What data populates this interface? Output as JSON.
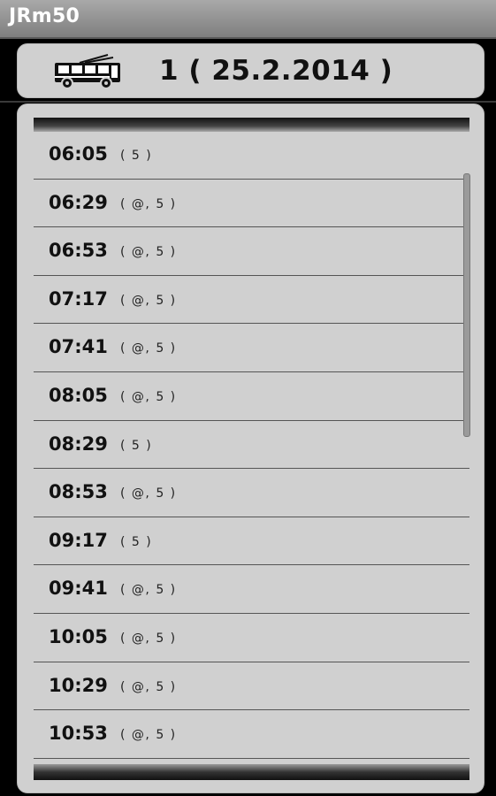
{
  "app": {
    "title": "JRm50"
  },
  "header": {
    "line_title": "1 ( 25.2.2014 )",
    "vehicle_icon": "trolleybus-icon"
  },
  "departures": [
    {
      "time": "06:05",
      "note": "( 5 )"
    },
    {
      "time": "06:29",
      "note": "( @, 5 )"
    },
    {
      "time": "06:53",
      "note": "( @, 5 )"
    },
    {
      "time": "07:17",
      "note": "( @, 5 )"
    },
    {
      "time": "07:41",
      "note": "( @, 5 )"
    },
    {
      "time": "08:05",
      "note": "( @, 5 )"
    },
    {
      "time": "08:29",
      "note": "( 5 )"
    },
    {
      "time": "08:53",
      "note": "( @, 5 )"
    },
    {
      "time": "09:17",
      "note": "( 5 )"
    },
    {
      "time": "09:41",
      "note": "( @, 5 )"
    },
    {
      "time": "10:05",
      "note": "( @, 5 )"
    },
    {
      "time": "10:29",
      "note": "( @, 5 )"
    },
    {
      "time": "10:53",
      "note": "( @, 5 )"
    }
  ]
}
